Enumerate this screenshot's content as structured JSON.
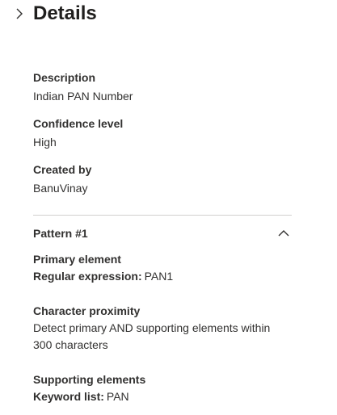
{
  "header": {
    "title": "Details"
  },
  "details": {
    "description_label": "Description",
    "description_value": "Indian PAN Number",
    "confidence_label": "Confidence level",
    "confidence_value": "High",
    "created_by_label": "Created by",
    "created_by_value": "BanuVinay"
  },
  "pattern": {
    "title": "Pattern #1",
    "primary_element_label": "Primary element",
    "regex_label": "Regular expression:",
    "regex_value": "PAN1",
    "proximity_label": "Character proximity",
    "proximity_value": "Detect primary AND supporting elements within 300 characters",
    "supporting_label": "Supporting elements",
    "keyword_label": "Keyword list:",
    "keyword_value": "PAN"
  },
  "icons": {
    "expand": "chevron-right-icon",
    "collapse": "chevron-up-icon"
  },
  "colors": {
    "text": "#323130",
    "title": "#201f1e",
    "divider": "#d2d0ce"
  }
}
